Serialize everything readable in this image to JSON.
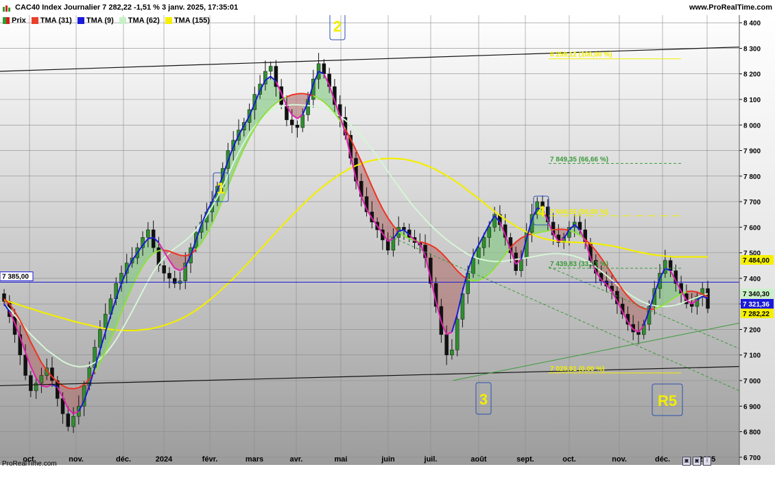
{
  "header": {
    "title": "CAC40 Index Journalier 7 282,22 -1,51 % 3 janv. 2025, 17:35:01",
    "brand": "www.ProRealTime.com"
  },
  "legend": [
    {
      "label": "Prix",
      "color": "#2e9e2e"
    },
    {
      "label": "TMA (31)",
      "color": "#e8402a"
    },
    {
      "label": "TMA (9)",
      "color": "#1a1ad8"
    },
    {
      "label": "TMA (62)",
      "color": "#c8f0c8"
    },
    {
      "label": "TMA (155)",
      "color": "#f5f000"
    }
  ],
  "footer": {
    "brand": "ProRealTime.com"
  },
  "tools": [
    "copy-icon",
    "copy-icon",
    "info-icon"
  ],
  "chart_data": {
    "type": "candlestick",
    "y_ticks": [
      "8 400",
      "8 300",
      "8 200",
      "8 100",
      "8 000",
      "7 900",
      "7 800",
      "7 700",
      "7 600",
      "7 500",
      "7 400",
      "7 300",
      "7 200",
      "7 100",
      "7 000",
      "6 900",
      "6 800",
      "6 700"
    ],
    "ylim": [
      6670,
      8430
    ],
    "x_ticks": [
      "oct.",
      "nov.",
      "déc.",
      "2024",
      "févr.",
      "mars",
      "avr.",
      "mai",
      "juin",
      "juil.",
      "août",
      "sept.",
      "oct.",
      "nov.",
      "déc.",
      "2025"
    ],
    "price_labels": [
      {
        "text": "7 484,00",
        "value": 7484,
        "color": "#f5f000"
      },
      {
        "text": "7 340,30",
        "value": 7340.3,
        "color": "#c8f0c8"
      },
      {
        "text": "7 321,36",
        "value": 7321.36,
        "color": "#1a1ad8"
      },
      {
        "text": "7 282,22",
        "value": 7282.22,
        "color": "#f5f000"
      }
    ],
    "hline": {
      "text": "7 385,00",
      "value": 7385
    },
    "fib_levels": [
      {
        "text": "8 259,12 (100,00 %)",
        "value": 8259.12
      },
      {
        "text": "7 849,35 (66,66 %)",
        "value": 7849.35
      },
      {
        "text": "7 644,55 (50,00 %)",
        "value": 7644.55
      },
      {
        "text": "7 439,83 (33,33 %)",
        "value": 7439.83
      },
      {
        "text": "7 029,91 (0,00 %)",
        "value": 7029.91
      }
    ],
    "wave_labels": [
      "2",
      "1",
      "4",
      "3",
      "R5"
    ],
    "series": [
      {
        "name": "Prix",
        "kind": "close",
        "values": [
          7310,
          7250,
          7180,
          7100,
          7020,
          6960,
          6990,
          7020,
          7050,
          7000,
          6930,
          6870,
          6820,
          6860,
          6900,
          6980,
          7050,
          7130,
          7200,
          7260,
          7320,
          7380,
          7420,
          7460,
          7480,
          7520,
          7560,
          7590,
          7520,
          7450,
          7420,
          7400,
          7380,
          7390,
          7460,
          7520,
          7580,
          7620,
          7660,
          7700,
          7760,
          7830,
          7900,
          7940,
          7980,
          8010,
          8060,
          8120,
          8160,
          8210,
          8230,
          8150,
          8080,
          8020,
          8000,
          7990,
          8040,
          8100,
          8180,
          8240,
          8200,
          8150,
          8080,
          8030,
          7960,
          7870,
          7780,
          7720,
          7660,
          7620,
          7590,
          7550,
          7510,
          7560,
          7600,
          7590,
          7560,
          7540,
          7530,
          7480,
          7380,
          7290,
          7180,
          7100,
          7120,
          7240,
          7340,
          7420,
          7480,
          7520,
          7560,
          7600,
          7650,
          7610,
          7560,
          7500,
          7430,
          7480,
          7580,
          7650,
          7700,
          7680,
          7620,
          7570,
          7540,
          7560,
          7600,
          7620,
          7590,
          7540,
          7470,
          7420,
          7390,
          7370,
          7350,
          7300,
          7260,
          7220,
          7190,
          7180,
          7220,
          7290,
          7360,
          7420,
          7470,
          7430,
          7380,
          7340,
          7300,
          7290,
          7330,
          7360,
          7282
        ]
      },
      {
        "name": "TMA (155)",
        "kind": "ma",
        "values": [
          7315,
          7308,
          7302,
          7295,
          7288,
          7282,
          7275,
          7268,
          7262,
          7256,
          7250,
          7244,
          7238,
          7232,
          7227,
          7222,
          7217,
          7212,
          7207,
          7203,
          7200,
          7198,
          7197,
          7196,
          7196,
          7197,
          7199,
          7201,
          7205,
          7210,
          7216,
          7223,
          7231,
          7240,
          7250,
          7262,
          7275,
          7290,
          7306,
          7323,
          7341,
          7360,
          7380,
          7400,
          7421,
          7443,
          7465,
          7488,
          7511,
          7534,
          7557,
          7580,
          7602,
          7624,
          7646,
          7667,
          7688,
          7708,
          7727,
          7745,
          7762,
          7778,
          7793,
          7807,
          7820,
          7831,
          7841,
          7849,
          7856,
          7861,
          7865,
          7868,
          7869,
          7869,
          7868,
          7866,
          7862,
          7857,
          7851,
          7843,
          7835,
          7825,
          7814,
          7802,
          7789,
          7775,
          7760,
          7744,
          7728,
          7712,
          7695,
          7678,
          7662,
          7646,
          7631,
          7617,
          7604,
          7592,
          7581,
          7572,
          7564,
          7557,
          7552,
          7548,
          7545,
          7543,
          7542,
          7541,
          7540,
          7539,
          7538,
          7536,
          7533,
          7530,
          7527,
          7523,
          7518,
          7513,
          7508,
          7503,
          7499,
          7495,
          7492,
          7489,
          7487,
          7485,
          7484,
          7484,
          7484,
          7484,
          7484,
          7484,
          7484
        ]
      },
      {
        "name": "TMA (62)",
        "kind": "ma",
        "values": [
          7300,
          7280,
          7255,
          7230,
          7205,
          7180,
          7160,
          7140,
          7120,
          7105,
          7090,
          7075,
          7065,
          7058,
          7054,
          7055,
          7060,
          7070,
          7085,
          7105,
          7130,
          7160,
          7195,
          7232,
          7270,
          7310,
          7350,
          7390,
          7425,
          7455,
          7480,
          7500,
          7517,
          7532,
          7548,
          7566,
          7588,
          7614,
          7645,
          7680,
          7718,
          7760,
          7805,
          7850,
          7893,
          7932,
          7966,
          7995,
          8020,
          8040,
          8055,
          8066,
          8073,
          8077,
          8079,
          8079,
          8078,
          8076,
          8074,
          8070,
          8064,
          8056,
          8046,
          8034,
          8019,
          8001,
          7980,
          7957,
          7932,
          7905,
          7877,
          7848,
          7818,
          7788,
          7759,
          7730,
          7703,
          7677,
          7653,
          7630,
          7608,
          7588,
          7569,
          7552,
          7536,
          7521,
          7507,
          7494,
          7484,
          7477,
          7472,
          7468,
          7466,
          7466,
          7468,
          7471,
          7474,
          7477,
          7480,
          7484,
          7488,
          7492,
          7495,
          7497,
          7497,
          7495,
          7492,
          7487,
          7480,
          7470,
          7458,
          7444,
          7428,
          7411,
          7393,
          7375,
          7358,
          7342,
          7328,
          7316,
          7306,
          7298,
          7293,
          7290,
          7290,
          7292,
          7296,
          7302,
          7310,
          7318,
          7326,
          7334,
          7340
        ]
      },
      {
        "name": "TMA (31)",
        "kind": "ma",
        "values": [
          7320,
          7300,
          7270,
          7235,
          7195,
          7150,
          7110,
          7070,
          7040,
          7015,
          6995,
          6980,
          6970,
          6968,
          6972,
          6985,
          7005,
          7035,
          7070,
          7112,
          7160,
          7212,
          7266,
          7318,
          7366,
          7410,
          7448,
          7478,
          7498,
          7508,
          7510,
          7506,
          7498,
          7490,
          7488,
          7495,
          7512,
          7538,
          7572,
          7612,
          7658,
          7708,
          7760,
          7812,
          7862,
          7908,
          7950,
          7988,
          8020,
          8046,
          8068,
          8086,
          8100,
          8110,
          8118,
          8122,
          8123,
          8120,
          8114,
          8104,
          8090,
          8071,
          8047,
          8018,
          7984,
          7945,
          7902,
          7856,
          7808,
          7760,
          7714,
          7672,
          7636,
          7606,
          7583,
          7566,
          7555,
          7548,
          7543,
          7538,
          7530,
          7518,
          7500,
          7478,
          7454,
          7430,
          7410,
          7396,
          7390,
          7392,
          7402,
          7418,
          7440,
          7466,
          7494,
          7520,
          7542,
          7558,
          7568,
          7574,
          7578,
          7582,
          7586,
          7590,
          7592,
          7592,
          7588,
          7580,
          7568,
          7552,
          7532,
          7508,
          7480,
          7450,
          7418,
          7386,
          7356,
          7330,
          7308,
          7292,
          7282,
          7278,
          7280,
          7288,
          7300,
          7314,
          7328,
          7340,
          7348,
          7350,
          7346,
          7338,
          7328
        ]
      },
      {
        "name": "TMA (9)",
        "kind": "ma",
        "values": [
          7300,
          7270,
          7225,
          7170,
          7110,
          7055,
          7010,
          6980,
          6975,
          6985,
          6975,
          6935,
          6890,
          6870,
          6880,
          6920,
          6980,
          7050,
          7120,
          7190,
          7255,
          7320,
          7380,
          7430,
          7470,
          7500,
          7530,
          7555,
          7560,
          7540,
          7505,
          7470,
          7440,
          7430,
          7445,
          7490,
          7550,
          7610,
          7660,
          7700,
          7745,
          7800,
          7860,
          7915,
          7960,
          7998,
          8035,
          8085,
          8135,
          8175,
          8190,
          8170,
          8125,
          8075,
          8040,
          8025,
          8040,
          8090,
          8160,
          8210,
          8200,
          8155,
          8095,
          8035,
          7968,
          7880,
          7790,
          7720,
          7670,
          7635,
          7605,
          7575,
          7545,
          7555,
          7585,
          7590,
          7570,
          7550,
          7535,
          7490,
          7400,
          7310,
          7230,
          7180,
          7190,
          7260,
          7350,
          7430,
          7490,
          7530,
          7570,
          7610,
          7645,
          7620,
          7570,
          7510,
          7455,
          7475,
          7555,
          7630,
          7675,
          7670,
          7625,
          7575,
          7545,
          7555,
          7590,
          7610,
          7590,
          7545,
          7480,
          7425,
          7395,
          7375,
          7350,
          7310,
          7270,
          7230,
          7200,
          7190,
          7215,
          7275,
          7340,
          7400,
          7440,
          7430,
          7390,
          7350,
          7315,
          7300,
          7315,
          7330,
          7321
        ]
      }
    ]
  }
}
